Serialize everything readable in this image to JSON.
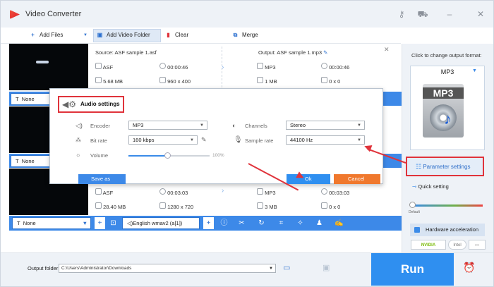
{
  "app": {
    "title": "Video Converter"
  },
  "toolbar": {
    "add_files": "Add Files",
    "add_video_folder": "Add Video Folder",
    "clear": "Clear",
    "merge": "Merge"
  },
  "files": [
    {
      "source": "Source: ASF sample 1.asf",
      "src_format": "ASF",
      "src_duration": "00:00:46",
      "src_size": "5.68 MB",
      "src_resolution": "960 x 400",
      "output": "Output: ASF sample 1.mp3",
      "out_format": "MP3",
      "out_duration": "00:00:46",
      "out_size": "1 MB",
      "out_resolution": "0 x 0"
    },
    {
      "src_format": "ASF",
      "src_duration": "00:03:03",
      "src_size": "28.40 MB",
      "src_resolution": "1280 x 720",
      "out_format": "MP3",
      "out_duration": "00:03:03",
      "out_size": "3 MB",
      "out_resolution": "0 x 0"
    }
  ],
  "row_bar": {
    "subtitle": "None",
    "audio_track": "English wmav2 (a[1])"
  },
  "dialog": {
    "title": "Audio settings",
    "encoder_label": "Encoder",
    "encoder_value": "MP3",
    "bitrate_label": "Bit rate",
    "bitrate_value": "160 kbps",
    "volume_label": "Volume",
    "volume_value": "100%",
    "volume_level": 0.5,
    "channels_label": "Channels",
    "channels_value": "Stereo",
    "samplerate_label": "Sample rate",
    "samplerate_value": "44100 Hz",
    "save_as": "Save as",
    "ok": "Ok",
    "cancel": "Cancel"
  },
  "right_panel": {
    "click_to_change": "Click to change output format:",
    "format": "MP3",
    "format_icon_text": "MP3",
    "parameter_settings": "Parameter settings",
    "quick_setting": "Quick setting",
    "default": "Default",
    "hardware_acceleration": "Hardware acceleration",
    "nvidia": "NVIDIA",
    "intel": "Intel"
  },
  "footer": {
    "output_folder_label": "Output folder:",
    "output_path": "C:\\Users\\Administrator\\Downloads",
    "run": "Run"
  },
  "colors": {
    "accent": "#3d89e8",
    "highlight": "#e0333b",
    "ok": "#2f8ff0",
    "cancel": "#f0782d"
  }
}
